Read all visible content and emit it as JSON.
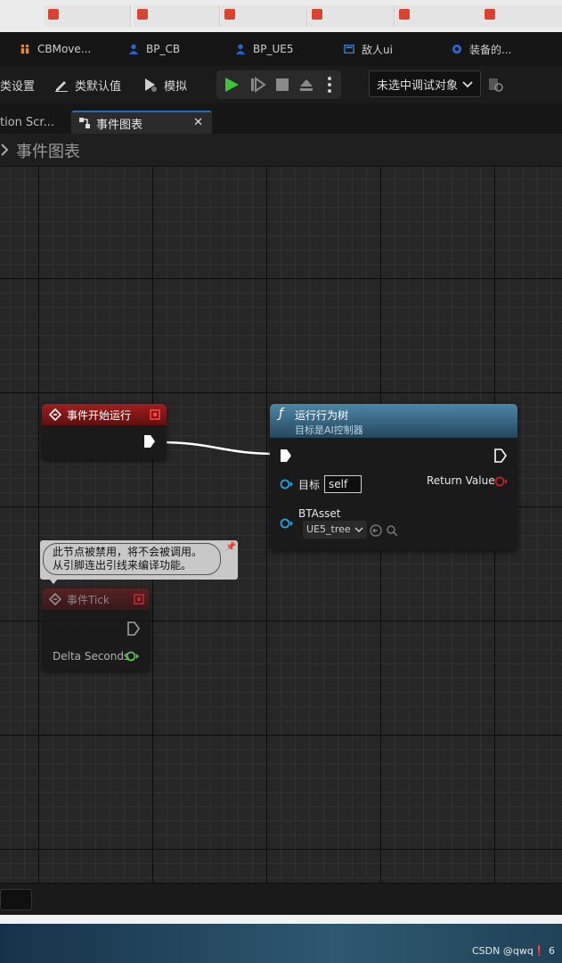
{
  "doc_tabs": [
    "CBMove...",
    "BP_CB",
    "BP_UE5",
    "敌人ui",
    "装备的..."
  ],
  "toolbar": {
    "class_settings": "类设置",
    "class_defaults": "类默认值",
    "simulate": "模拟",
    "debug_object": "未选中调试对象"
  },
  "editor_tabs": {
    "prev_tab": "tion Scr...",
    "active_tab": "事件图表"
  },
  "graph": {
    "title": "事件图表"
  },
  "nodes": {
    "begin_play": {
      "title": "事件开始运行"
    },
    "run_bt": {
      "title": "运行行为树",
      "subtitle": "目标是AI控制器",
      "target_label": "目标",
      "target_value": "self",
      "return_label": "Return Value",
      "btasset_label": "BTAsset",
      "btasset_value": "UE5_tree"
    },
    "disabled_comment": {
      "line1": "此节点被禁用，将不会被调用。",
      "line2": "从引脚连出引线来编译功能。"
    },
    "tick": {
      "title": "事件Tick",
      "delta_label": "Delta Seconds"
    }
  },
  "watermark": "CSDN @qwq❗ 6",
  "colors": {
    "event_red": "#8a1a1a",
    "function_blue": "#3b6f8a",
    "object_pin": "#1ea3e0",
    "float_pin": "#5ad25a",
    "bool_pin": "#c81e1e",
    "play_green": "#37c837"
  }
}
